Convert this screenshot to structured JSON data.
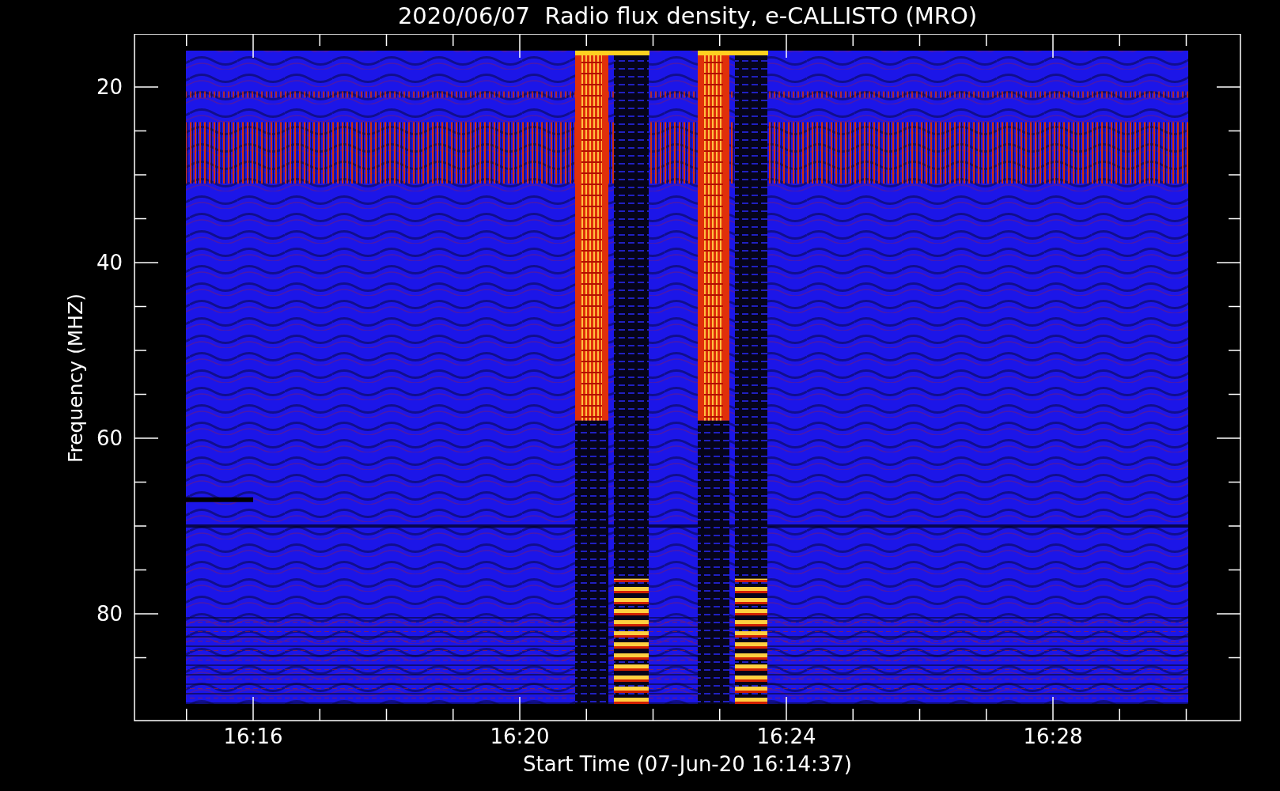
{
  "title": "2020/06/07  Radio flux density, e-CALLISTO (MRO)",
  "y_axis": {
    "label": "Frequency (MHZ)",
    "ticks": [
      "20",
      "40",
      "60",
      "80"
    ]
  },
  "x_axis": {
    "label": "Start Time (07-Jun-20 16:14:37)",
    "ticks": [
      "16:16",
      "16:20",
      "16:24",
      "16:28"
    ]
  }
}
